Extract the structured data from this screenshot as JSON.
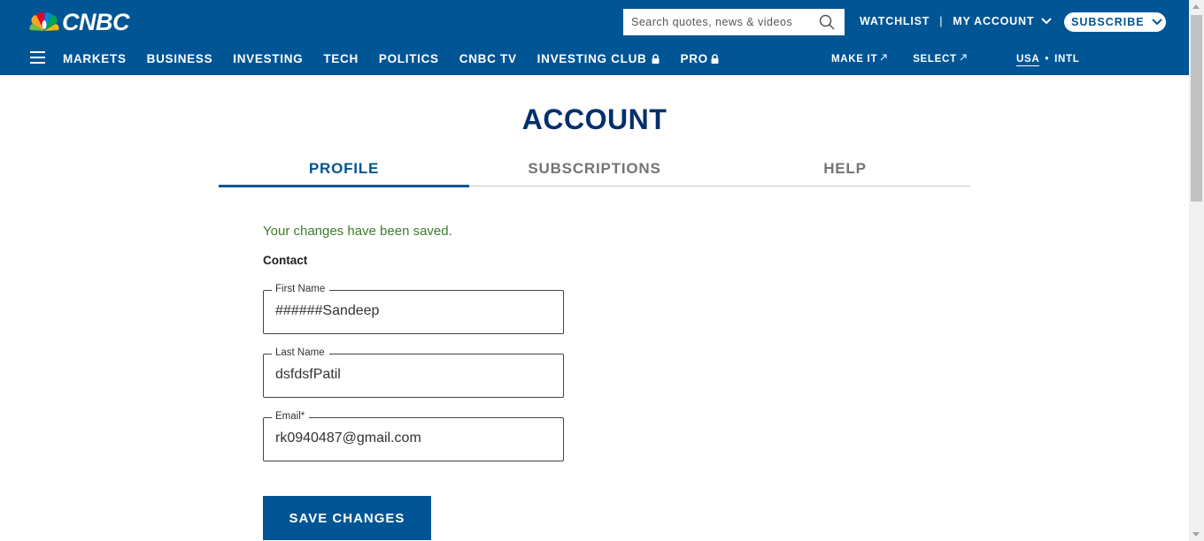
{
  "header": {
    "logo_text": "CNBC",
    "search": {
      "placeholder": "Search quotes, news & videos",
      "value": ""
    },
    "top_links": {
      "watchlist": "WATCHLIST",
      "separator": "|",
      "my_account": "MY ACCOUNT"
    },
    "subscribe_label": "SUBSCRIBE",
    "nav": {
      "items": [
        {
          "label": "MARKETS"
        },
        {
          "label": "BUSINESS"
        },
        {
          "label": "INVESTING"
        },
        {
          "label": "TECH"
        },
        {
          "label": "POLITICS"
        },
        {
          "label": "CNBC TV"
        },
        {
          "label": "INVESTING CLUB",
          "icon": "lock-icon"
        },
        {
          "label": "PRO",
          "icon": "lock-icon"
        }
      ],
      "external": [
        {
          "label": "MAKE IT",
          "icon": "external-link-icon"
        },
        {
          "label": "SELECT",
          "icon": "external-link-icon"
        }
      ],
      "region": {
        "usa": "USA",
        "dot": "•",
        "intl": "INTL"
      }
    }
  },
  "main": {
    "title": "ACCOUNT",
    "tabs": [
      {
        "label": "PROFILE",
        "active": true
      },
      {
        "label": "SUBSCRIPTIONS",
        "active": false
      },
      {
        "label": "HELP",
        "active": false
      }
    ],
    "saved_message": "Your changes have been saved.",
    "contact_heading": "Contact",
    "fields": {
      "first_name": {
        "label": "First Name",
        "value": "######Sandeep"
      },
      "last_name": {
        "label": "Last Name",
        "value": "dsfdsfPatil"
      },
      "email": {
        "label": "Email",
        "required_mark": "*",
        "value": "rk0940487@gmail.com"
      }
    },
    "save_label": "SAVE CHANGES"
  },
  "colors": {
    "brand_blue": "#005594",
    "title_navy": "#002f6c",
    "success_green": "#3a7d2a"
  }
}
